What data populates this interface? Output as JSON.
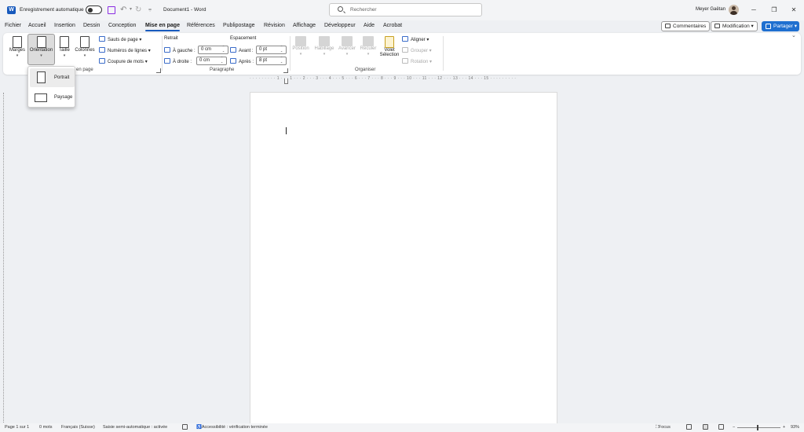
{
  "titlebar": {
    "app_logo": "W",
    "autosave_label": "Enregistrement automatique",
    "doc_title": "Document1  -  Word",
    "search_placeholder": "Rechercher",
    "user_name": "Meyer Gaëtan",
    "icons": [
      "save-icon",
      "undo-icon",
      "redo-icon",
      "customize-qat-icon",
      "search-icon",
      "minimize-icon",
      "restore-icon",
      "close-icon"
    ]
  },
  "tabs": [
    "Fichier",
    "Accueil",
    "Insertion",
    "Dessin",
    "Conception",
    "Mise en page",
    "Références",
    "Publipostage",
    "Révision",
    "Affichage",
    "Développeur",
    "Aide",
    "Acrobat"
  ],
  "active_tab": "Mise en page",
  "header_buttons": {
    "comments": "Commentaires",
    "editing": "Modification",
    "share": "Partager"
  },
  "ribbon": {
    "mise_en_page_group": {
      "label": "en page",
      "margins": "Marges",
      "orientation": "Orientation",
      "size": "Taille",
      "columns": "Colonnes",
      "breaks": "Sauts de page",
      "line_numbers": "Numéros de lignes",
      "hyphenation": "Coupure de mots"
    },
    "paragraph_group": {
      "label": "Paragraphe",
      "indent_heading": "Retrait",
      "spacing_heading": "Espacement",
      "left_label": "À gauche :",
      "left_value": "0 cm",
      "right_label": "À droite :",
      "right_value": "0 cm",
      "before_label": "Avant :",
      "before_value": "0 pt",
      "after_label": "Après :",
      "after_value": "8 pt"
    },
    "arrange_group": {
      "label": "Organiser",
      "position": "Position",
      "wrap": "Habillage",
      "forward": "Avancer",
      "backward": "Reculer",
      "selection_pane_line1": "Volet",
      "selection_pane_line2": "Sélection",
      "align": "Aligner",
      "group": "Grouper",
      "rotate": "Rotation"
    }
  },
  "orientation_menu": {
    "portrait": "Portrait",
    "landscape": "Paysage",
    "hovered": "Portrait"
  },
  "ruler_text": "· · · · · · · · · 1 · · · 1 · · · 2 · · · 3 · · · 4 · · · 5 · · · 6 · · · 7 · · · 8 · · · 9 · · · 10 · · · 11 · · · 12 · · · 13 · · · 14 · · · 15 · · · · · · · · ·",
  "statusbar": {
    "page": "Page 1 sur 1",
    "words": "0 mots",
    "language": "Français (Suisse)",
    "text_predictions": "Saisie semi-automatique : activée",
    "accessibility": "Accessibilité : vérification terminée",
    "focus": "Focus",
    "zoom": "93%",
    "zoom_minus": "−",
    "zoom_plus": "+"
  },
  "colors": {
    "accent": "#185abd",
    "share_button": "#1f6fd0",
    "save_icon": "#8a2be2"
  }
}
